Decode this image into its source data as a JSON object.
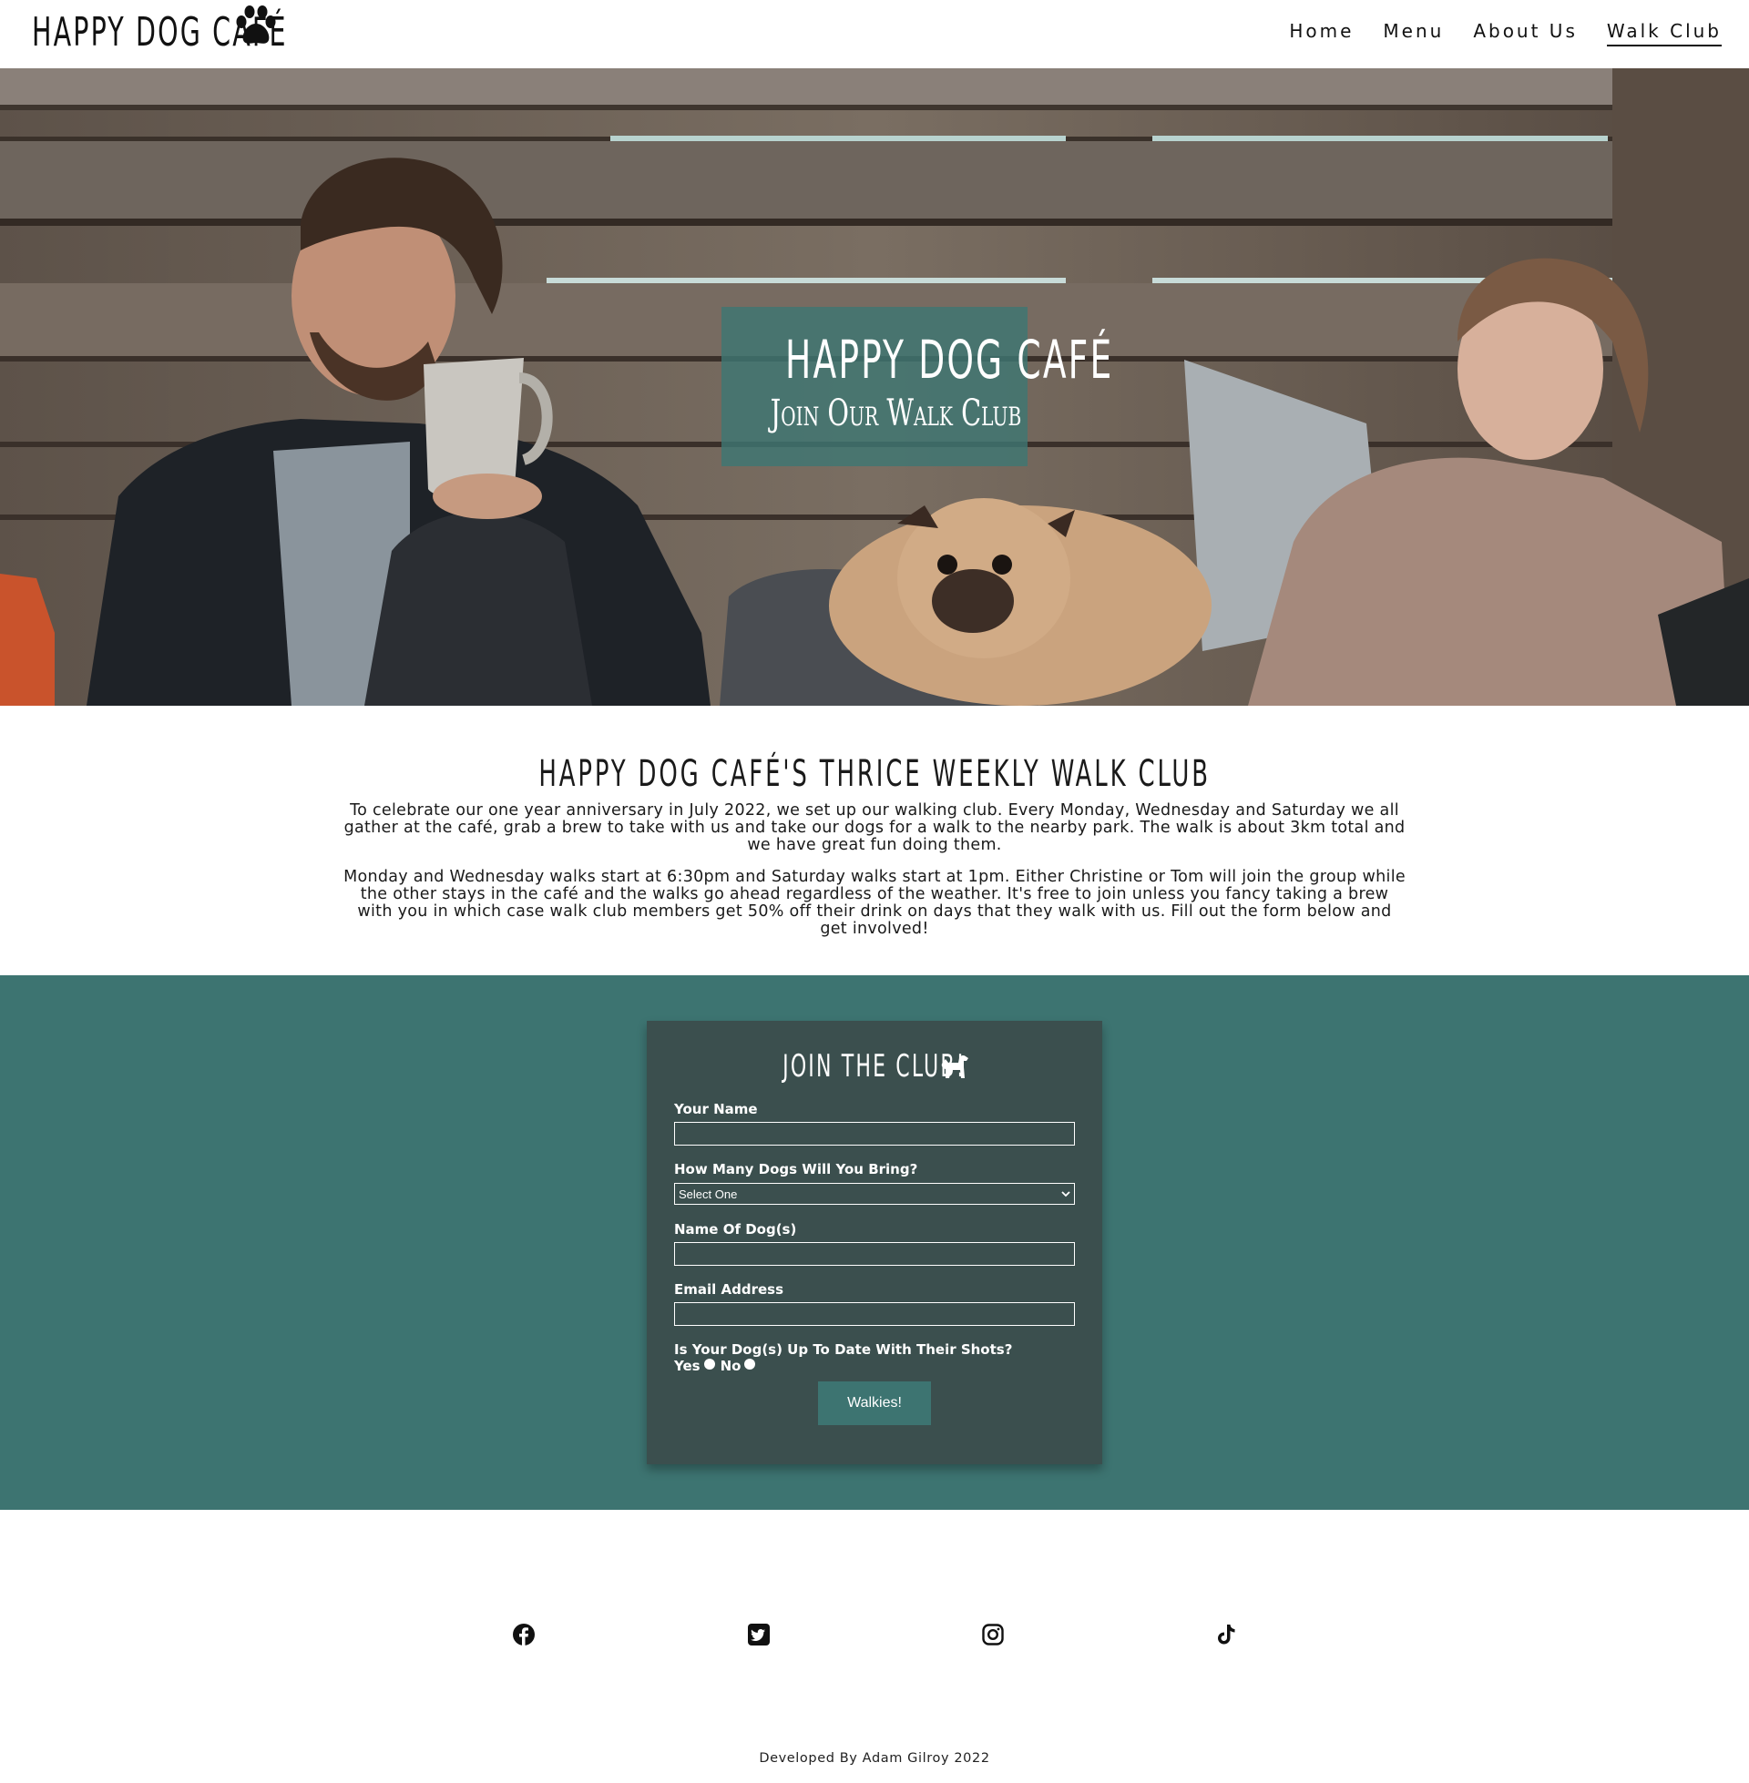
{
  "header": {
    "logo_text": "HAPPY DOG CAFÉ",
    "logo_icon": "paw-icon",
    "nav": [
      {
        "label": "Home",
        "active": false
      },
      {
        "label": "Menu",
        "active": false
      },
      {
        "label": "About Us",
        "active": false
      },
      {
        "label": "Walk Club",
        "active": true
      }
    ]
  },
  "hero": {
    "title": "HAPPY DOG CAFÉ",
    "subtitle": "Join Our Walk Club",
    "overlay_color": "#3e7673"
  },
  "intro": {
    "heading": "HAPPY DOG CAFÉ'S THRICE WEEKLY WALK CLUB",
    "paragraph_1": "To celebrate our one year anniversary in July 2022, we set up our walking club. Every Monday, Wednesday and Saturday we all gather at the café, grab a brew to take with us and take our dogs for a walk to the nearby park. The walk is about 3km total and we have great fun doing them.",
    "paragraph_2": "Monday and Wednesday walks start at 6:30pm and Saturday walks start at 1pm. Either Christine or Tom will join the group while the other stays in the café and the walks go ahead regardless of the weather. It's free to join unless you fancy taking a brew with you in which case walk club members get 50% off their drink on days that they walk with us. Fill out the form below and get involved!"
  },
  "form": {
    "title": "JOIN THE CLUB!",
    "title_icon": "dog-icon",
    "name_label": "Your Name",
    "name_value": "",
    "dogs_count_label": "How Many Dogs Will You Bring?",
    "dogs_count_selected": "Select One",
    "dog_names_label": "Name Of Dog(s)",
    "dog_names_value": "",
    "email_label": "Email Address",
    "email_value": "",
    "shots_label": "Is Your Dog(s) Up To Date With Their Shots?",
    "shots_options": [
      "Yes",
      "No"
    ],
    "submit_label": "Walkies!",
    "section_color": "#3d7471",
    "card_color": "#3b4f4e"
  },
  "footer": {
    "social_icons": [
      "facebook-icon",
      "twitter-icon",
      "instagram-icon",
      "tiktok-icon"
    ],
    "credit": "Developed By Adam Gilroy 2022"
  }
}
